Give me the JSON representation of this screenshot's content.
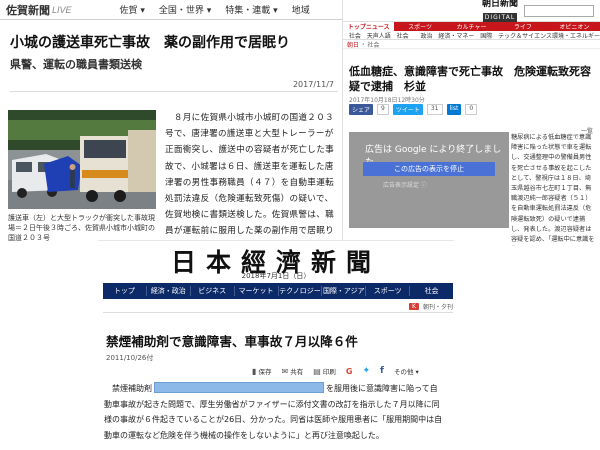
{
  "saga": {
    "logo": "佐賀新聞",
    "logo_sub": "LIVE",
    "nav": [
      "佐賀 ▾",
      "全国・世界 ▾",
      "特集・連載 ▾",
      "地域"
    ],
    "headline": "小城の護送車死亡事故　薬の副作用で居眠り",
    "subhead": "県警、運転の職員書類送検",
    "date": "2017/11/7",
    "caption": "護送車（左）と大型トラックが衝突した事故現場＝２日午後３時ごろ、佐賀県小城市小城町の国道２０３号",
    "body": "　８月に佐賀県小城市小城町の国道２０３号で、唐津署の護送車と大型トレーラーが正面衝突し、護送中の容疑者が死亡した事故で、小城署は６日、護送車を運転した唐津署の男性事務職員（４７）を自動車運転処罰法違反（危険運転致死傷）の疑いで、佐賀地検に書類送検した。佐賀県警は、職員が運転前に服用した薬の副作用で居眠りし、中央線をはみ出したと明らかにした。"
  },
  "asahi": {
    "brand_top": "朝日新聞",
    "brand_bottom": "DIGITAL",
    "nav1": [
      "トップニュース",
      "スポーツ",
      "カルチャー",
      "ライフ",
      "オピニオン"
    ],
    "nav2": [
      "社会",
      "天声人語",
      "社会",
      "政治",
      "経済・マネー",
      "国際",
      "テック＆サイエンス",
      "環境・エネルギー"
    ],
    "crumb": [
      "朝日",
      "社会"
    ],
    "title": "低血糖症、意識障害で死亡事故　危険運転致死容疑で逮捕　杉並",
    "meta": "2017年10月18日12時30分",
    "share": [
      {
        "label": "シェア",
        "count": "9"
      },
      {
        "label": "ツイート",
        "count": "31"
      },
      {
        "label": "list",
        "count": "0"
      }
    ],
    "overlay_msg": "広告は Google により終了しました。",
    "overlay_stop": "この広告の表示を停止",
    "overlay_settings": "広告表示設定 ⓘ",
    "article": "糖尿病による低血糖症で意識障害に陥った状態で車を運転し、交通整理中の警備員男性を死亡させる事故を起こしたとして、警視庁は１８日、埼玉県越谷市七左町１丁目、無職渡辺純一郎容疑者（５１）を自動車運転処罰法違反（危険運転致死）の疑いで逮捕し、発表した。渡辺容疑者は容疑を認め、「運転中に意識を失ってしま",
    "sidebar_head": "一覧"
  },
  "nikkei": {
    "masthead": "日本經濟新聞",
    "mdate": "2018年7月1日（日）",
    "nav": [
      "トップ",
      "経済・政治",
      "ビジネス",
      "マーケット",
      "テクノロジー",
      "国際・アジア",
      "スポーツ",
      "社会"
    ],
    "sub_badge": "K",
    "sub_text": "朝刊・夕刊",
    "title": "禁煙補助剤で意識障害、車事故７月以降６件",
    "date": "2011/10/26付",
    "tools": {
      "save": "保存",
      "share": "共有",
      "print": "印刷",
      "other": "その他"
    },
    "body_before": "　禁煙補助剤",
    "body_after": "を服用後に意識障害に陥って自動車事故が起きた問題で、厚生労働省がファイザーに添付文書の改訂を指示した７月以降に同様の事故が６件起きていることが26日、分かった。同省は医師や服用患者に「服用期間中は自動車の運転など危険を伴う機械の操作をしないように」と再び注意喚起した。"
  }
}
